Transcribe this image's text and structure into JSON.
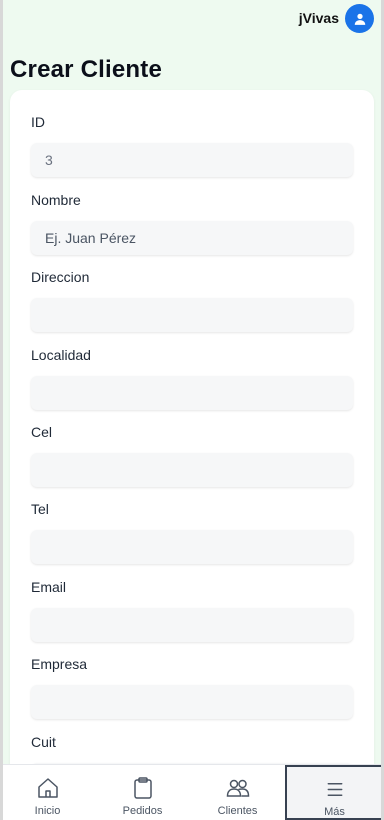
{
  "header": {
    "username": "jVivas",
    "avatar_icon": "user-icon",
    "accent": "#1a73e8"
  },
  "page": {
    "title": "Crear Cliente"
  },
  "form": {
    "fields": [
      {
        "label": "ID",
        "value": "3",
        "placeholder": ""
      },
      {
        "label": "Nombre",
        "value": "",
        "placeholder": "Ej. Juan Pérez"
      },
      {
        "label": "Direccion",
        "value": "",
        "placeholder": ""
      },
      {
        "label": "Localidad",
        "value": "",
        "placeholder": ""
      },
      {
        "label": "Cel",
        "value": "",
        "placeholder": ""
      },
      {
        "label": "Tel",
        "value": "",
        "placeholder": ""
      },
      {
        "label": "Email",
        "value": "",
        "placeholder": ""
      },
      {
        "label": "Empresa",
        "value": "",
        "placeholder": ""
      },
      {
        "label": "Cuit",
        "value": "",
        "placeholder": ""
      }
    ]
  },
  "nav": {
    "items": [
      {
        "label": "Inicio",
        "icon": "home-icon"
      },
      {
        "label": "Pedidos",
        "icon": "clipboard-icon"
      },
      {
        "label": "Clientes",
        "icon": "users-icon"
      },
      {
        "label": "Más",
        "icon": "menu-icon",
        "active": true
      }
    ]
  }
}
